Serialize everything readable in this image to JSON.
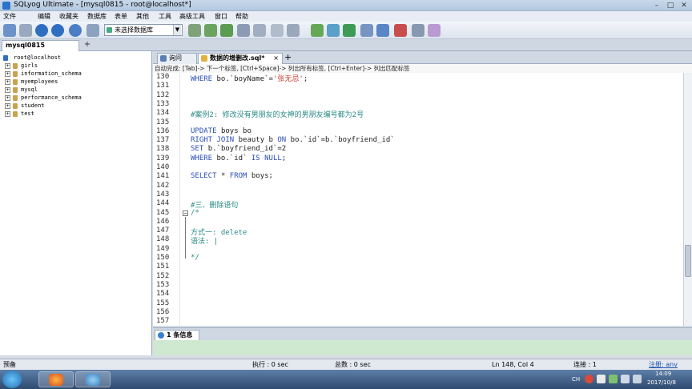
{
  "window": {
    "title": "SQLyog Ultimate - [mysql0815 - root@localhost*]"
  },
  "menu": [
    "文件",
    "编辑",
    "收藏夹",
    "数据库",
    "表单",
    "其他",
    "工具",
    "高级工具",
    "窗口",
    "帮助"
  ],
  "toolbar": {
    "db_select": "未选择数据库"
  },
  "connection_tab": {
    "label": "mysql0815",
    "add": "+"
  },
  "tree": {
    "root": "root@localhost",
    "databases": [
      "girls",
      "information_schema",
      "myemployees",
      "mysql",
      "performance_schema",
      "student",
      "test"
    ]
  },
  "editor_tabs": [
    {
      "label": "询问"
    },
    {
      "label": "数据的增删改.sql*"
    }
  ],
  "editor_tab_add": "+",
  "hint": "自动完成: [Tab]-> 下一个标签, [Ctrl+Space]-> 列出所有标签, [Ctrl+Enter]-> 列出匹配标签",
  "editor": {
    "lines": [
      {
        "n": "130",
        "parts": [
          {
            "c": "kw",
            "t": "WHERE "
          },
          {
            "c": "plain",
            "t": "bo.`boyName`="
          },
          {
            "c": "str",
            "t": "'张无忌'"
          },
          {
            "c": "plain",
            "t": ";"
          }
        ]
      },
      {
        "n": "131",
        "parts": []
      },
      {
        "n": "132",
        "parts": []
      },
      {
        "n": "133",
        "parts": []
      },
      {
        "n": "134",
        "parts": [
          {
            "c": "cmt",
            "t": "#案例2: 修改没有男朋友的女神的男朋友编号都为2号"
          }
        ]
      },
      {
        "n": "135",
        "parts": []
      },
      {
        "n": "136",
        "parts": [
          {
            "c": "kw",
            "t": "UPDATE "
          },
          {
            "c": "plain",
            "t": "boys bo"
          }
        ]
      },
      {
        "n": "137",
        "parts": [
          {
            "c": "kw",
            "t": "RIGHT JOIN "
          },
          {
            "c": "plain",
            "t": "beauty b "
          },
          {
            "c": "kw",
            "t": "ON "
          },
          {
            "c": "plain",
            "t": "bo.`id`=b.`boyfriend_id`"
          }
        ]
      },
      {
        "n": "138",
        "parts": [
          {
            "c": "kw",
            "t": "SET "
          },
          {
            "c": "plain",
            "t": "b.`boyfriend_id`=2"
          }
        ]
      },
      {
        "n": "139",
        "parts": [
          {
            "c": "kw",
            "t": "WHERE "
          },
          {
            "c": "plain",
            "t": "bo.`id` "
          },
          {
            "c": "kw",
            "t": "IS NULL"
          },
          {
            "c": "plain",
            "t": ";"
          }
        ]
      },
      {
        "n": "140",
        "parts": []
      },
      {
        "n": "141",
        "parts": [
          {
            "c": "kw",
            "t": "SELECT "
          },
          {
            "c": "plain",
            "t": "* "
          },
          {
            "c": "kw",
            "t": "FROM "
          },
          {
            "c": "plain",
            "t": "boys;"
          }
        ]
      },
      {
        "n": "142",
        "parts": []
      },
      {
        "n": "143",
        "parts": []
      },
      {
        "n": "144",
        "parts": [
          {
            "c": "cmt",
            "t": "#三、删除语句"
          }
        ]
      },
      {
        "n": "145",
        "parts": [
          {
            "c": "cmt",
            "t": "/*"
          }
        ]
      },
      {
        "n": "146",
        "parts": []
      },
      {
        "n": "147",
        "parts": [
          {
            "c": "cmt",
            "t": "方式一: delete"
          }
        ]
      },
      {
        "n": "148",
        "parts": [
          {
            "c": "cmt",
            "t": "语法: |"
          }
        ]
      },
      {
        "n": "149",
        "parts": []
      },
      {
        "n": "150",
        "parts": [
          {
            "c": "cmt",
            "t": "*/"
          }
        ]
      },
      {
        "n": "151",
        "parts": []
      },
      {
        "n": "152",
        "parts": []
      },
      {
        "n": "153",
        "parts": []
      },
      {
        "n": "154",
        "parts": []
      },
      {
        "n": "155",
        "parts": []
      },
      {
        "n": "156",
        "parts": []
      },
      {
        "n": "157",
        "parts": []
      }
    ]
  },
  "results": {
    "tab_label": "1 条信息"
  },
  "status": {
    "left": "预备",
    "exec": "执行 : 0 sec",
    "total": "总数 : 0 sec",
    "pos": "Ln 148, Col 4",
    "conn": "连接 : 1",
    "reg": "注册: anv"
  },
  "tray": {
    "ime": "CH",
    "time": "14:09",
    "date": "2017/10/8"
  },
  "colors": {
    "keyword": "#2b4eb5",
    "string": "#c0392b",
    "comment": "#2a8a86",
    "result_bg": "#cfe8d0"
  }
}
